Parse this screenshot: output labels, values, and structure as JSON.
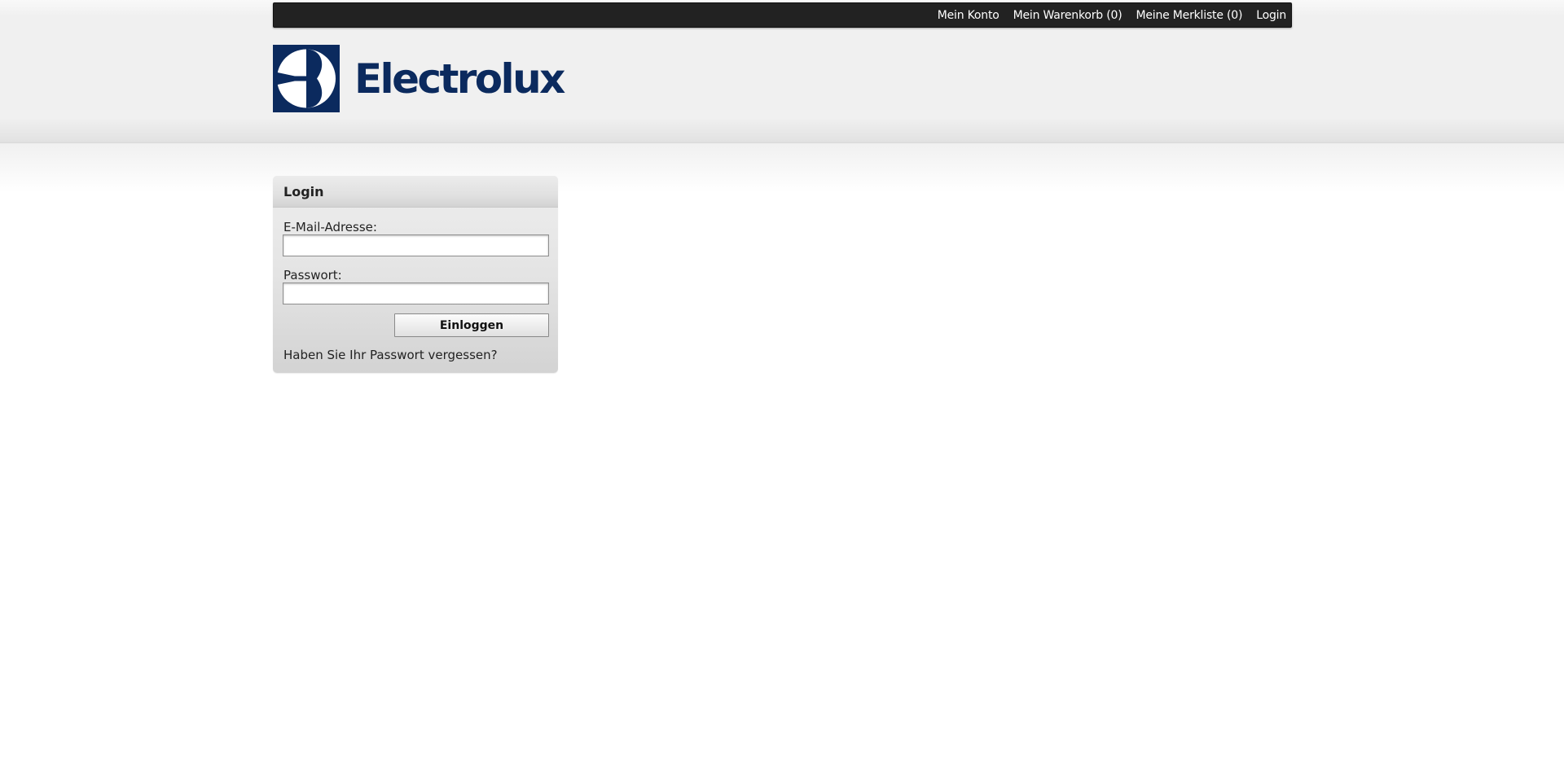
{
  "topnav": {
    "account": "Mein Konto",
    "cart": "Mein Warenkorb (0)",
    "wishlist": "Meine Merkliste (0)",
    "login": "Login"
  },
  "logo": {
    "text": "Electrolux",
    "icon": "electrolux-logo-icon",
    "brand_color": "#0b2a5e"
  },
  "login_box": {
    "title": "Login",
    "email_label": "E-Mail-Adresse:",
    "email_value": "",
    "password_label": "Passwort:",
    "password_value": "",
    "submit_label": "Einloggen",
    "forgot_password": "Haben Sie Ihr Passwort vergessen?"
  },
  "colors": {
    "topbar_bg": "#222222",
    "header_bg": "#f0f0f0",
    "page_bg": "#ffffff"
  }
}
